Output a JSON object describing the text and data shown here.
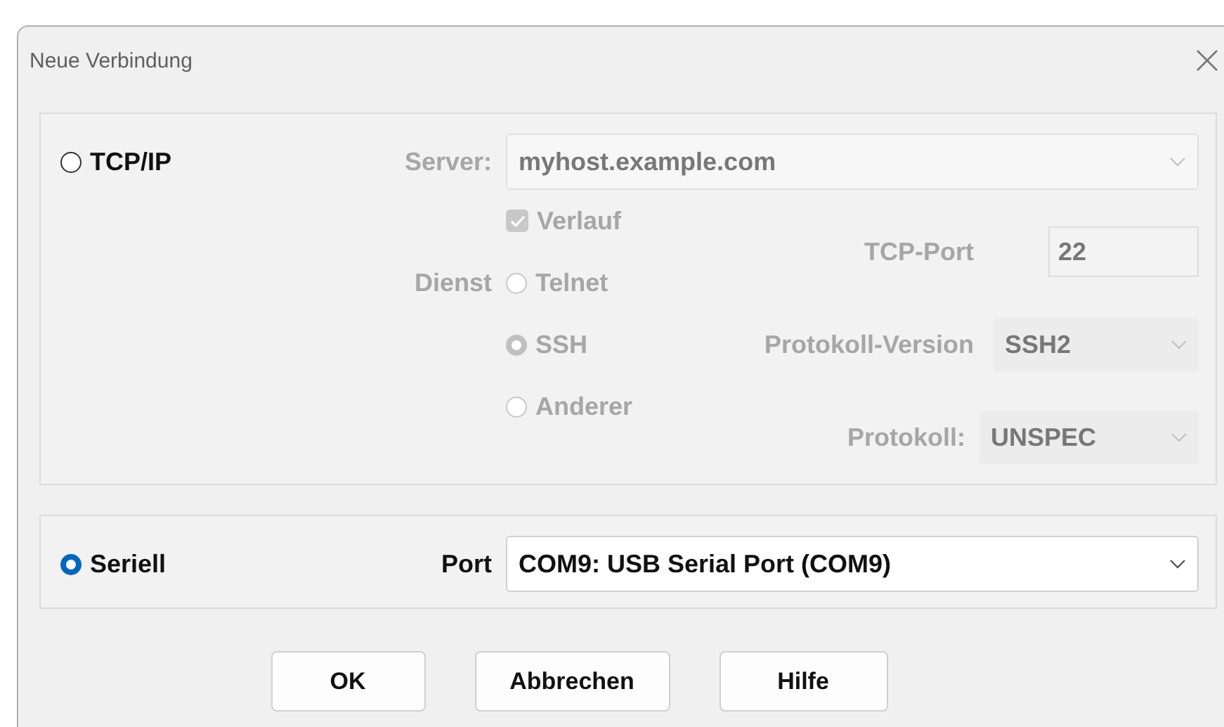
{
  "window": {
    "title": "Neue Verbindung"
  },
  "tcpip": {
    "label": "TCP/IP",
    "selected": false,
    "disabled": true,
    "server_label": "Server:",
    "server": "myhost.example.com",
    "history": {
      "label": "Verlauf",
      "checked": true
    },
    "service_label": "Dienst",
    "services": [
      {
        "label": "Telnet",
        "selected": false
      },
      {
        "label": "SSH",
        "selected": true
      },
      {
        "label": "Anderer",
        "selected": false
      }
    ],
    "tcp_port_label": "TCP-Port",
    "tcp_port": "22",
    "protocol_version_label": "Protokoll-Version",
    "protocol_version": "SSH2",
    "protocol_label": "Protokoll:",
    "protocol": "UNSPEC"
  },
  "serial": {
    "label": "Seriell",
    "selected": true,
    "port_label": "Port",
    "port": "COM9: USB Serial Port (COM9)"
  },
  "buttons": [
    {
      "label": "OK"
    },
    {
      "label": "Abbrechen"
    },
    {
      "label": "Hilfe"
    }
  ]
}
